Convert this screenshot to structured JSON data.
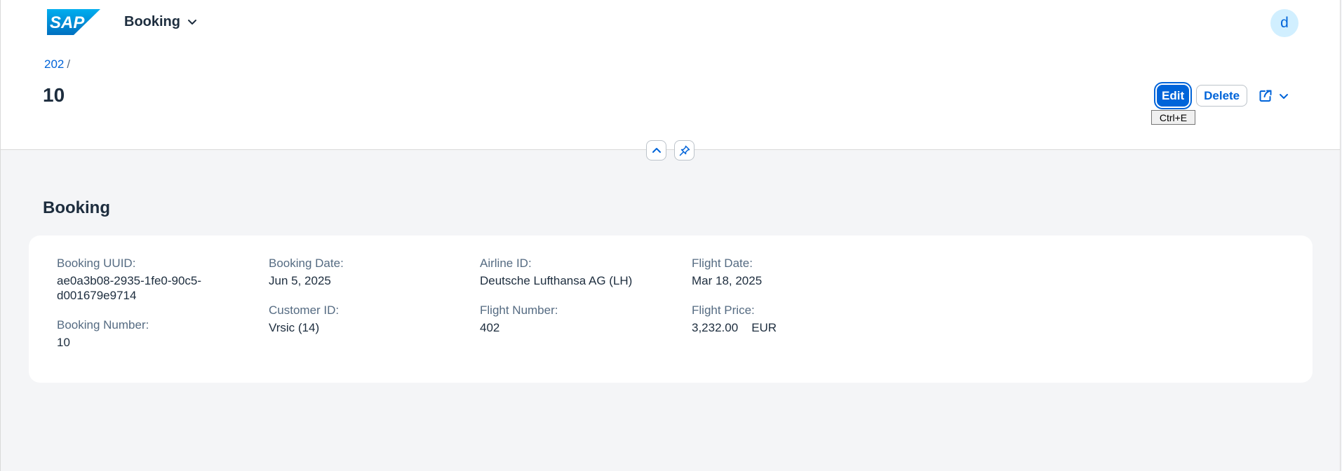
{
  "shell": {
    "app_title": "Booking",
    "avatar_initial": "d",
    "logo_text": "SAP"
  },
  "header": {
    "breadcrumb": [
      {
        "label": "202"
      }
    ],
    "breadcrumb_separator": "/",
    "title": "10",
    "actions": {
      "edit": "Edit",
      "delete": "Delete"
    },
    "tooltip": "Ctrl+E"
  },
  "section": {
    "title": "Booking",
    "fields": {
      "booking_uuid": {
        "label": "Booking UUID:",
        "value": "ae0a3b08-2935-1fe0-90c5-d001679e9714"
      },
      "booking_number": {
        "label": "Booking Number:",
        "value": "10"
      },
      "booking_date": {
        "label": "Booking Date:",
        "value": "Jun 5, 2025"
      },
      "customer_id": {
        "label": "Customer ID:",
        "value": "Vrsic (14)"
      },
      "airline_id": {
        "label": "Airline ID:",
        "value": "Deutsche Lufthansa AG (LH)"
      },
      "flight_number": {
        "label": "Flight Number:",
        "value": "402"
      },
      "flight_date": {
        "label": "Flight Date:",
        "value": "Mar 18, 2025"
      },
      "flight_price": {
        "label": "Flight Price:",
        "value": "3,232.00",
        "currency": "EUR"
      }
    }
  },
  "colors": {
    "accent": "#0064d9",
    "shell_bg": "#ffffff",
    "page_bg": "#f4f5f7",
    "text": "#1d2d3e",
    "label": "#556b82"
  },
  "icons": [
    "chevron-down-icon",
    "share-icon",
    "collapse-icon",
    "pin-icon"
  ]
}
